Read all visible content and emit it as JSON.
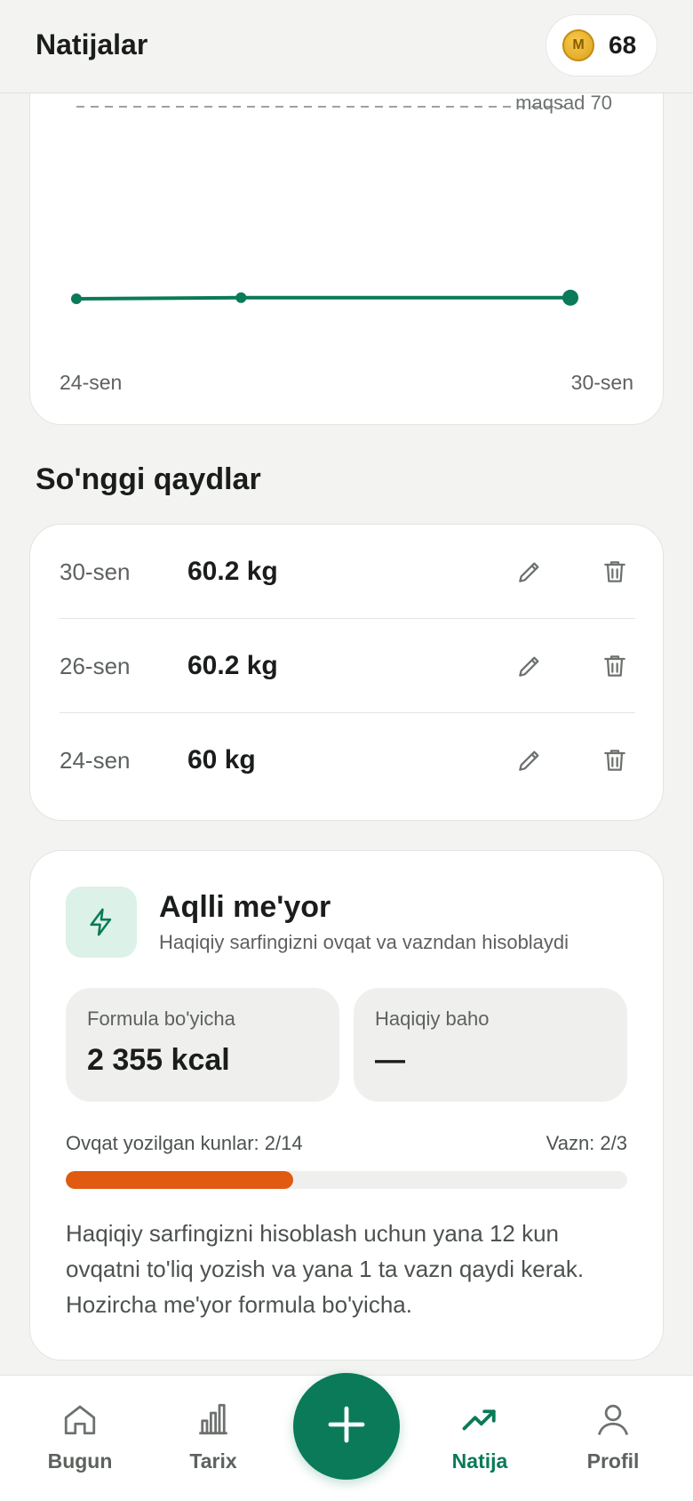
{
  "header": {
    "title": "Natijalar",
    "coin_badge": "M",
    "coin_count": "68"
  },
  "chart_data": {
    "type": "line",
    "goal_label": "maqsad 70",
    "goal_value": 70,
    "x_labels": [
      "24-sen",
      "30-sen"
    ],
    "points": [
      {
        "date": "24-sen",
        "value": 60
      },
      {
        "date": "26-sen",
        "value": 60.2
      },
      {
        "date": "30-sen",
        "value": 60.2
      }
    ],
    "series_color": "#0a7a58"
  },
  "records": {
    "title": "So'nggi qaydlar",
    "items": [
      {
        "date": "30-sen",
        "weight": "60.2 kg"
      },
      {
        "date": "26-sen",
        "weight": "60.2 kg"
      },
      {
        "date": "24-sen",
        "weight": "60 kg"
      }
    ],
    "edit_icon": "pencil-icon",
    "delete_icon": "trash-icon"
  },
  "smart": {
    "title": "Aqlli me'yor",
    "subtitle": "Haqiqiy sarfingizni ovqat va vazndan hisoblaydi",
    "formula_label": "Formula bo'yicha",
    "formula_value": "2 355 kcal",
    "actual_label": "Haqiqiy baho",
    "actual_value": "—",
    "progress_left": "Ovqat yozilgan kunlar: 2/14",
    "progress_right": "Vazn: 2/3",
    "progress_fraction": 0.405,
    "progress_color": "#e05a12",
    "note": "Haqiqiy sarfingizni hisoblash uchun yana 12 kun ovqatni to'liq yozish va yana 1 ta vazn qaydi kerak. Hozircha me'yor formula bo'yicha."
  },
  "nav": {
    "items": [
      {
        "label": "Bugun",
        "icon": "home-icon"
      },
      {
        "label": "Tarix",
        "icon": "bar-chart-icon"
      },
      {
        "label": "Natija",
        "icon": "trending-up-icon",
        "active": true
      },
      {
        "label": "Profil",
        "icon": "user-icon"
      }
    ],
    "fab_icon": "plus-icon",
    "active_color": "#0a7a58"
  }
}
